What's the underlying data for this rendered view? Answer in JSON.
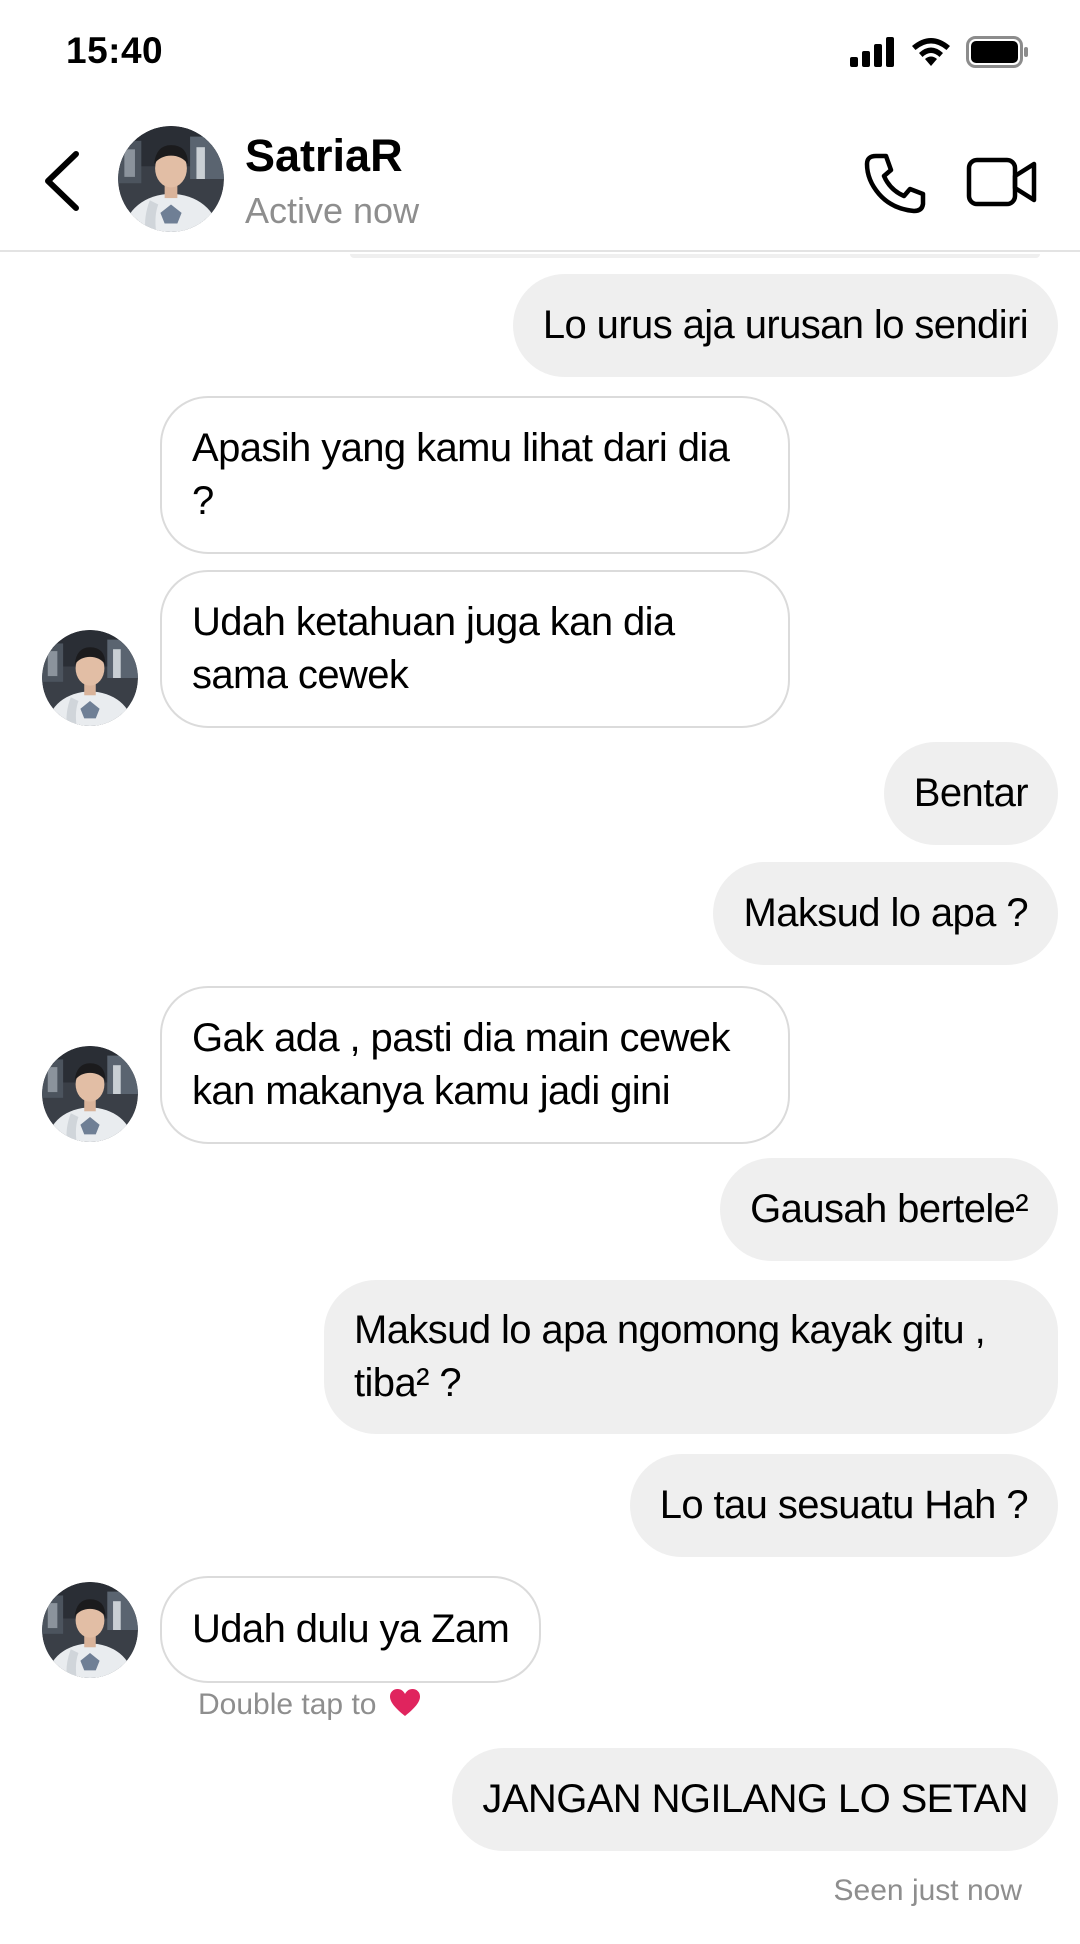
{
  "status_bar": {
    "time": "15:40"
  },
  "header": {
    "name": "SatriaR",
    "status": "Active now"
  },
  "messages": [
    {
      "side": "out",
      "text": "Lo urus aja urusan lo sendiri"
    },
    {
      "side": "in",
      "text": "Apasih yang kamu lihat dari dia ?"
    },
    {
      "side": "in",
      "text": "Udah ketahuan juga kan dia sama cewek"
    },
    {
      "side": "out",
      "text": "Bentar"
    },
    {
      "side": "out",
      "text": "Maksud lo apa ?"
    },
    {
      "side": "in",
      "text": "Gak ada , pasti dia main cewek kan makanya kamu jadi gini"
    },
    {
      "side": "out",
      "text": "Gausah bertele²"
    },
    {
      "side": "out",
      "text": "Maksud lo apa ngomong kayak gitu , tiba² ?"
    },
    {
      "side": "out",
      "text": "Lo tau sesuatu Hah ?"
    },
    {
      "side": "in",
      "text": "Udah dulu ya Zam"
    },
    {
      "side": "out",
      "text": "JANGAN NGILANG LO SETAN"
    }
  ],
  "hint": {
    "text": "Double tap to",
    "icon": "heart-icon",
    "color": "#e0245e"
  },
  "seen": "Seen just now",
  "colors": {
    "outgoing_bubble": "#efefef",
    "incoming_border": "#dbdbdb",
    "muted_text": "#8e8e8e"
  }
}
